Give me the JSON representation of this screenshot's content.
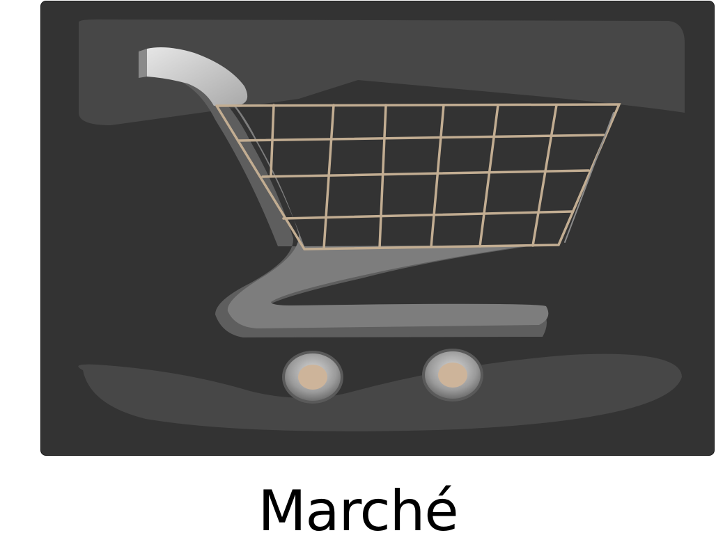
{
  "caption": "Marché",
  "icon": {
    "name": "shopping-cart-icon",
    "colors": {
      "background": "#333333",
      "highlight": "#474747",
      "frame": "#7d7d7d",
      "frame_dark": "#5e5e5e",
      "handle": "#d6d6d6",
      "basket_wire": "#c2ad92",
      "wheel_hub": "#cdb49a",
      "wheel_rim": "#bdbdbd"
    }
  }
}
